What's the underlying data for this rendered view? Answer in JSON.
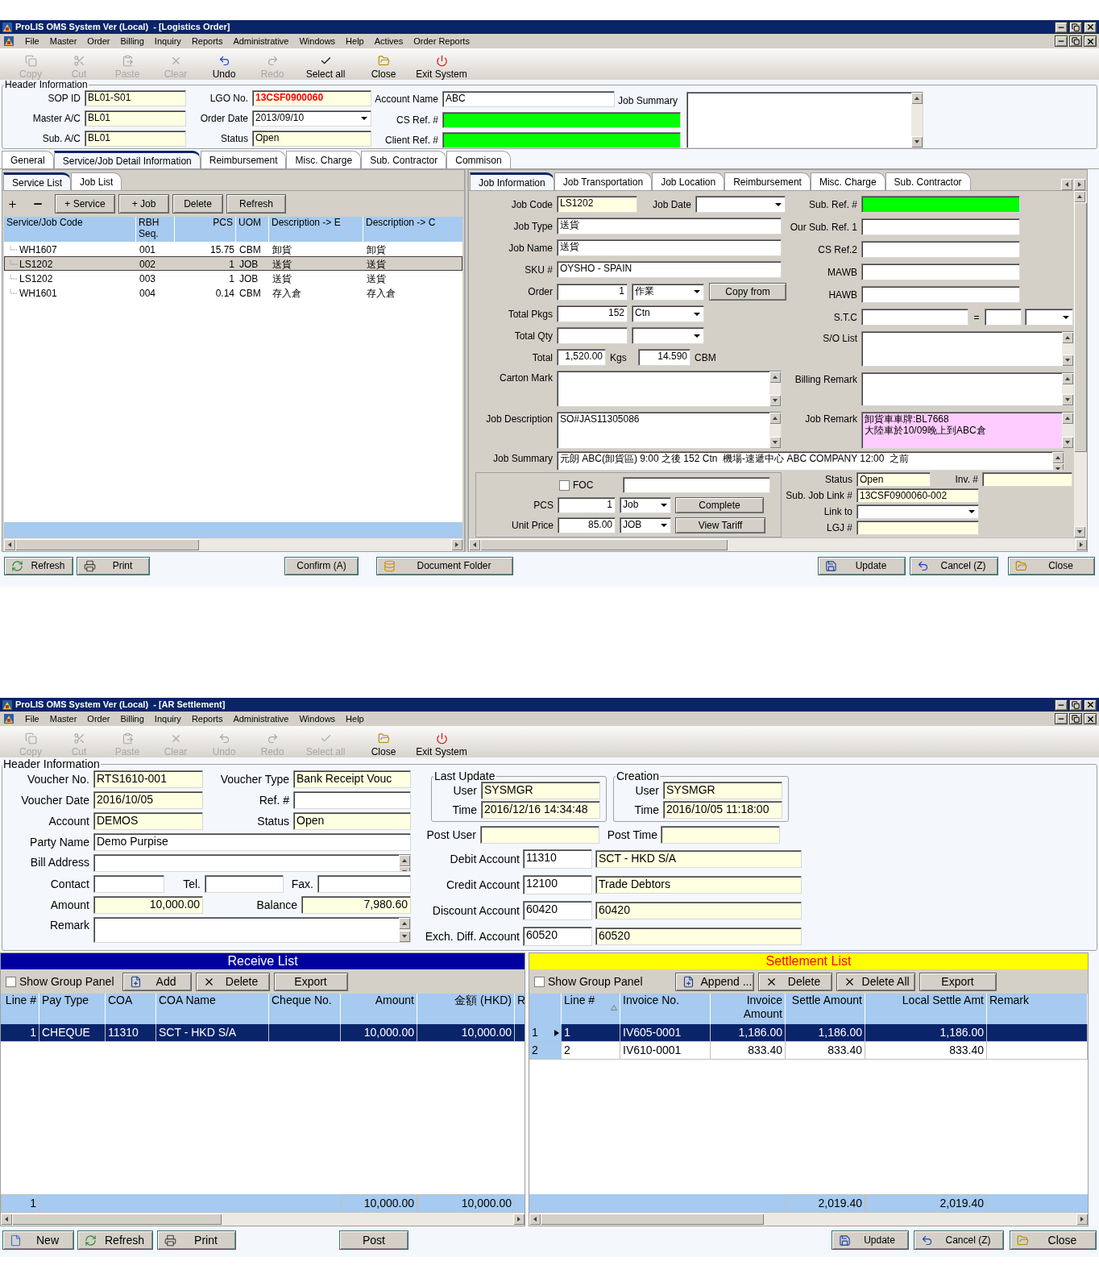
{
  "order_window": {
    "title": "ProLIS OMS System Ver (Local)  - [Logistics Order]",
    "menu": [
      "File",
      "Master",
      "Order",
      "Billing",
      "Inquiry",
      "Reports",
      "Administrative",
      "Windows",
      "Help",
      "Actives",
      "Order Reports"
    ],
    "toolbar": [
      {
        "label": "Copy",
        "disabled": true
      },
      {
        "label": "Cut",
        "disabled": true
      },
      {
        "label": "Paste",
        "disabled": true
      },
      {
        "label": "Clear",
        "disabled": true
      },
      {
        "label": "Undo",
        "disabled": false
      },
      {
        "label": "Redo",
        "disabled": true
      },
      {
        "label": "Select all",
        "disabled": false
      },
      {
        "label": "Close",
        "disabled": false
      },
      {
        "label": "Exit System",
        "disabled": false
      }
    ],
    "header": {
      "title": "Header Information",
      "sop_id": {
        "label": "SOP ID",
        "value": "BL01-S01",
        "readonly": true
      },
      "master_ac": {
        "label": "Master A/C",
        "value": "BL01",
        "readonly": true
      },
      "sub_ac": {
        "label": "Sub. A/C",
        "value": "BL01",
        "readonly": true
      },
      "lgo_no": {
        "label": "LGO No.",
        "value": "13CSF0900060",
        "readonly": true,
        "alert": true
      },
      "order_date": {
        "label": "Order Date",
        "value": "2013/09/10",
        "kind": "dropdown"
      },
      "status": {
        "label": "Status",
        "value": "Open",
        "readonly": true
      },
      "account_name": {
        "label": "Account Name",
        "value": "ABC"
      },
      "cs_ref": {
        "label": "CS Ref. #",
        "required": true
      },
      "client_ref": {
        "label": "Client Ref. #",
        "required": true
      },
      "job_summary": {
        "label": "Job Summary",
        "kind": "memo"
      }
    },
    "tabs": [
      {
        "label": "General",
        "selected": false
      },
      {
        "label": "Service/Job Detail Information",
        "selected": true
      },
      {
        "label": "Reimbursement",
        "selected": false
      },
      {
        "label": "Misc. Charge",
        "selected": false
      },
      {
        "label": "Sub. Contractor",
        "selected": false
      },
      {
        "label": "Commison",
        "selected": false
      }
    ],
    "service_panel": {
      "tabs": [
        {
          "label": "Service List",
          "selected": true
        },
        {
          "label": "Job List",
          "selected": false
        }
      ],
      "buttons": [
        "+ Service",
        "+ Job",
        "Delete",
        "Refresh"
      ],
      "columns": [
        "Service/Job Code",
        "RBH Seq.",
        "PCS",
        "UOM",
        "Description  -> E",
        "Description  -> C"
      ],
      "rows": [
        {
          "cells": [
            "WH1607",
            "001",
            "15.75",
            "CBM",
            "卸貨",
            "卸貨"
          ],
          "selected": false
        },
        {
          "cells": [
            "LS1202",
            "002",
            "1",
            "JOB",
            "送貨",
            "送貨"
          ],
          "selected": true
        },
        {
          "cells": [
            "LS1202",
            "003",
            "1",
            "JOB",
            "送貨",
            "送貨"
          ],
          "selected": false
        },
        {
          "cells": [
            "WH1601",
            "004",
            "0.14",
            "CBM",
            "存入倉",
            "存入倉"
          ],
          "selected": false
        }
      ]
    },
    "job_panel": {
      "tabs": [
        {
          "label": "Job Information",
          "selected": true
        },
        {
          "label": "Job Transportation",
          "selected": false
        },
        {
          "label": "Job Location",
          "selected": false
        },
        {
          "label": "Reimbursement",
          "selected": false
        },
        {
          "label": "Misc. Charge",
          "selected": false
        },
        {
          "label": "Sub. Contractor",
          "selected": false
        }
      ],
      "job_code": {
        "label": "Job Code",
        "value": "LS1202",
        "readonly": true
      },
      "job_date": {
        "label": "Job Date",
        "kind": "dropdown"
      },
      "job_type": {
        "label": "Job Type",
        "value": "送貨"
      },
      "job_name": {
        "label": "Job Name",
        "value": "送貨"
      },
      "sku": {
        "label": "SKU #",
        "value": "OYSHO - SPAIN"
      },
      "order": {
        "label": "Order",
        "value": "1",
        "kind": "number"
      },
      "order_unit": {
        "value": "作業",
        "kind": "dropdown"
      },
      "copy_from": "Copy from",
      "total_pkgs": {
        "label": "Total Pkgs",
        "value": "152",
        "kind": "number"
      },
      "pkgs_unit": {
        "value": "Ctn",
        "kind": "dropdown"
      },
      "total_qty": {
        "label": "Total Qty"
      },
      "qty_unit": {
        "kind": "dropdown"
      },
      "total_weight": {
        "label": "Total",
        "value": "1,520.00",
        "kind": "number"
      },
      "weight_unit": "Kgs",
      "total_volume": {
        "value": "14.590",
        "kind": "number"
      },
      "volume_unit": "CBM",
      "carton_mark": {
        "label": "Carton Mark",
        "kind": "memo"
      },
      "job_description": {
        "label": "Job Description",
        "value": "SO#JAS11305086",
        "kind": "memo"
      },
      "job_summary": {
        "label": "Job Summary",
        "value": "元朗 ABC(卸貨區) 9:00 之後 152 Ctn  機場-速遞中心 ABC COMPANY 12:00  之前",
        "kind": "memo"
      },
      "sub_ref": {
        "label": "Sub. Ref. #",
        "required": true
      },
      "our_sub_ref": {
        "label": "Our Sub. Ref. 1"
      },
      "cs_ref2": {
        "label": "CS Ref.2"
      },
      "mawb": {
        "label": "MAWB"
      },
      "hawb": {
        "label": "HAWB"
      },
      "stc": {
        "label": "S.T.C"
      },
      "stc_equals": "=",
      "stc_unit": {
        "kind": "dropdown"
      },
      "so_list": {
        "label": "S/O List",
        "kind": "memo"
      },
      "billing_remark": {
        "label": "Billing Remark",
        "kind": "memo"
      },
      "job_remark": {
        "label": "Job Remark",
        "value": "卸貨車車牌:BL7668\n大陸車於10/09晚上到ABC倉",
        "highlighted": true,
        "kind": "memo"
      },
      "foc": {
        "label": "FOC",
        "checked": false
      },
      "pcs": {
        "label": "PCS",
        "value": "1",
        "kind": "number"
      },
      "pcs_unit": {
        "value": "Job",
        "kind": "dropdown"
      },
      "complete": "Complete",
      "unit_price": {
        "label": "Unit Price",
        "value": "85.00",
        "kind": "number"
      },
      "price_unit": {
        "value": "JOB",
        "kind": "dropdown"
      },
      "view_tariff": "View Tariff",
      "status": {
        "label": "Status",
        "value": "Open",
        "readonly": true
      },
      "inv_no": {
        "label": "Inv. #",
        "readonly": true
      },
      "sub_job_link": {
        "label": "Sub. Job Link #",
        "value": "13CSF0900060-002",
        "readonly": true
      },
      "link_to": {
        "label": "Link to",
        "kind": "dropdown"
      },
      "lgj_no": {
        "label": "LGJ #",
        "readonly": true
      }
    },
    "footer": [
      "Refresh",
      "Print",
      "Confirm (A)",
      "Document Folder",
      "Update",
      "Cancel (Z)",
      "Close"
    ]
  },
  "settlement_window": {
    "title": "ProLIS OMS System Ver (Local)  - [AR Settlement]",
    "menu": [
      "File",
      "Master",
      "Order",
      "Billing",
      "Inquiry",
      "Reports",
      "Administrative",
      "Windows",
      "Help"
    ],
    "toolbar": [
      {
        "label": "Copy",
        "disabled": true
      },
      {
        "label": "Cut",
        "disabled": true
      },
      {
        "label": "Paste",
        "disabled": true
      },
      {
        "label": "Clear",
        "disabled": true
      },
      {
        "label": "Undo",
        "disabled": true
      },
      {
        "label": "Redo",
        "disabled": true
      },
      {
        "label": "Select all",
        "disabled": true
      },
      {
        "label": "Close",
        "disabled": false
      },
      {
        "label": "Exit System",
        "disabled": false
      }
    ],
    "header": {
      "title": "Header Information",
      "voucher_no": {
        "label": "Voucher No.",
        "value": "RTS1610-001",
        "readonly": true
      },
      "voucher_type": {
        "label": "Voucher Type",
        "value": "Bank Receipt Vouc",
        "readonly": true
      },
      "voucher_date": {
        "label": "Voucher Date",
        "value": "2016/10/05",
        "readonly": true
      },
      "ref_no": {
        "label": "Ref. #"
      },
      "account": {
        "label": "Account",
        "value": "DEMOS",
        "readonly": true
      },
      "status": {
        "label": "Status",
        "value": "Open",
        "readonly": true
      },
      "party_name": {
        "label": "Party Name",
        "value": "Demo Purpise"
      },
      "bill_address": {
        "label": "Bill Address",
        "kind": "memo"
      },
      "contact": {
        "label": "Contact"
      },
      "tel": {
        "label": "Tel."
      },
      "fax": {
        "label": "Fax."
      },
      "amount": {
        "label": "Amount",
        "value": "10,000.00",
        "readonly": true,
        "kind": "number"
      },
      "balance": {
        "label": "Balance",
        "value": "7,980.60",
        "readonly": true,
        "kind": "number"
      },
      "remark": {
        "label": "Remark",
        "kind": "memo"
      },
      "audit": [
        {
          "title": "Last Update",
          "user": {
            "label": "User",
            "value": "SYSMGR",
            "readonly": true
          },
          "time": {
            "label": "Time",
            "value": "2016/12/16 14:34:48",
            "readonly": true
          }
        },
        {
          "title": "Creation",
          "user": {
            "label": "User",
            "value": "SYSMGR",
            "readonly": true
          },
          "time": {
            "label": "Time",
            "value": "2016/10/05 11:18:00",
            "readonly": true
          }
        }
      ],
      "post_user": {
        "label": "Post User",
        "readonly": true
      },
      "post_time": {
        "label": "Post Time",
        "readonly": true
      },
      "accounts": [
        {
          "label": "Debit Account",
          "code": {
            "value": "11310"
          },
          "name": {
            "value": "SCT - HKD S/A",
            "readonly": true
          }
        },
        {
          "label": "Credit Account",
          "code": {
            "value": "12100"
          },
          "name": {
            "value": "Trade Debtors",
            "readonly": true
          }
        },
        {
          "label": "Discount Account",
          "code": {
            "value": "60420"
          },
          "name": {
            "value": "60420",
            "readonly": true
          }
        },
        {
          "label": "Exch. Diff. Account",
          "code": {
            "value": "60520"
          },
          "name": {
            "value": "60520",
            "readonly": true
          }
        }
      ]
    },
    "receive_list": {
      "title": "Receive List",
      "group_panel": {
        "label": "Show Group Panel",
        "checked": false
      },
      "buttons": [
        "Add",
        "Delete",
        "Export"
      ],
      "columns": [
        "Line #",
        "Pay Type",
        "COA",
        "COA Name",
        "Cheque No.",
        "Amount",
        "金額 (HKD)",
        "R"
      ],
      "rows": [
        {
          "line": "1",
          "pay_type": "CHEQUE",
          "coa": "11310",
          "coa_name": "SCT - HKD S/A",
          "amount": "10,000.00",
          "amount_hkd": "10,000.00",
          "selected": true
        }
      ],
      "totals": {
        "line": "1",
        "amount": "10,000.00",
        "amount_hkd": "10,000.00"
      }
    },
    "settlement_list": {
      "title": "Settlement List",
      "group_panel": {
        "label": "Show Group Panel",
        "checked": false
      },
      "buttons": [
        "Append ...",
        "Delete",
        "Delete All",
        "Export"
      ],
      "columns": [
        "Line #",
        "Invoice No.",
        "Invoice Amount",
        "Settle Amount",
        "Local Settle Amt",
        "Remark"
      ],
      "rows": [
        {
          "indicator": "1",
          "current": true,
          "line": "1",
          "invoice_no": "IV605-0001",
          "invoice_amount": "1,186.00",
          "settle_amount": "1,186.00",
          "local_settle_amt": "1,186.00",
          "selected": true
        },
        {
          "indicator": "2",
          "current": false,
          "line": "2",
          "invoice_no": "IV610-0001",
          "invoice_amount": "833.40",
          "settle_amount": "833.40",
          "local_settle_amt": "833.40",
          "selected": false
        }
      ],
      "totals": {
        "settle_amount": "2,019.40",
        "local_settle_amt": "2,019.40"
      }
    },
    "footer": [
      "New",
      "Refresh",
      "Print",
      "Post",
      "Update",
      "Cancel (Z)",
      "Close"
    ]
  }
}
